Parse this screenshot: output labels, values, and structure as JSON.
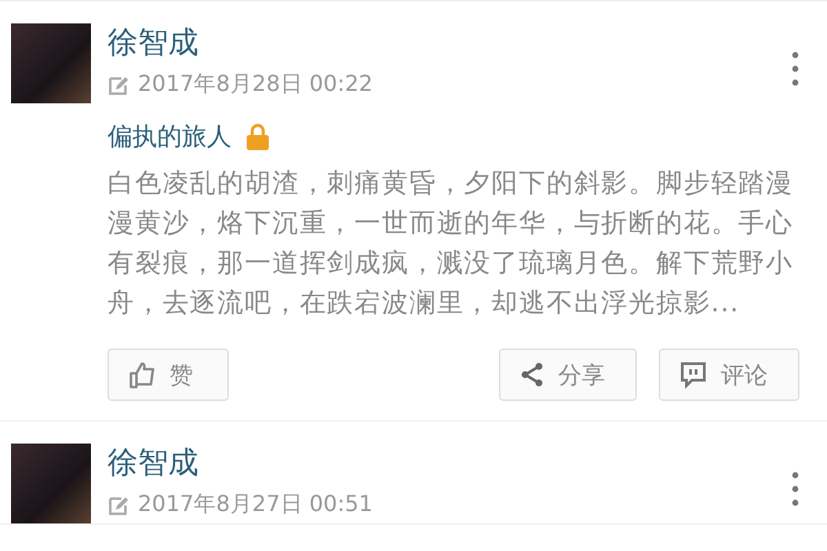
{
  "posts": [
    {
      "author": "徐智成",
      "date": "2017年8月28日 00:22",
      "title": "偏执的旅人",
      "locked": true,
      "body": "白色凌乱的胡渣，刺痛黄昏，夕阳下的斜影。脚步轻踏漫漫黄沙，烙下沉重，一世而逝的年华，与折断的花。手心有裂痕，那一道挥剑成疯，溅没了琉璃月色。解下荒野小舟，去逐流吧，在跌宕波澜里，却逃不出浮光掠影...",
      "actions": [
        {
          "kind": "like",
          "label": "赞"
        },
        {
          "kind": "share",
          "label": "分享"
        },
        {
          "kind": "comment",
          "label": "评论"
        }
      ]
    },
    {
      "author": "徐智成",
      "date": "2017年8月27日 00:51"
    }
  ]
}
